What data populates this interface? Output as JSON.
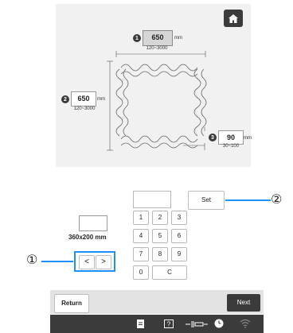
{
  "top": {
    "width": {
      "badge": "1",
      "value": "650",
      "unit": "mm",
      "range": "120~3000"
    },
    "height": {
      "badge": "2",
      "value": "650",
      "unit": "mm",
      "range": "120~3000"
    },
    "spacing": {
      "badge": "3",
      "value": "90",
      "unit": "mm",
      "range": "30~100"
    },
    "home_icon": "home-icon"
  },
  "keypad": {
    "keys": [
      "1",
      "2",
      "3",
      "4",
      "5",
      "6",
      "7",
      "8",
      "9",
      "0",
      "C"
    ],
    "set_label": "Set"
  },
  "frame": {
    "size_label": "360x200 mm",
    "prev": "<",
    "next": ">"
  },
  "callouts": {
    "one": "①",
    "two": "②"
  },
  "footer": {
    "return_label": "Return",
    "next_label": "Next"
  },
  "status_icons": [
    "document-icon",
    "help-icon",
    "thread-icon",
    "clock-icon",
    "wifi-icon"
  ],
  "colors": {
    "highlight": "#1e90ff",
    "dark_button": "#3b3b3b"
  }
}
